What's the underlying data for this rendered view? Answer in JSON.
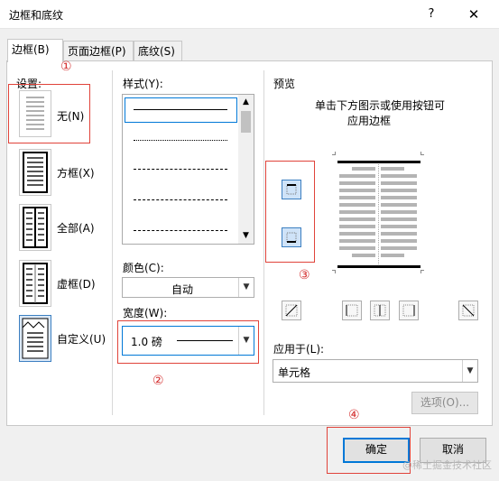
{
  "window": {
    "title": "边框和底纹",
    "help": "?",
    "close": "✕"
  },
  "tabs": [
    {
      "label": "边框(B)",
      "active": true
    },
    {
      "label": "页面边框(P)",
      "active": false
    },
    {
      "label": "底纹(S)",
      "active": false
    }
  ],
  "settings": {
    "heading": "设置:",
    "items": [
      {
        "label": "无(N)"
      },
      {
        "label": "方框(X)"
      },
      {
        "label": "全部(A)"
      },
      {
        "label": "虚框(D)"
      },
      {
        "label": "自定义(U)"
      }
    ]
  },
  "style": {
    "heading": "样式(Y):"
  },
  "color": {
    "heading": "颜色(C):",
    "value": "自动"
  },
  "width": {
    "heading": "宽度(W):",
    "value": "1.0 磅"
  },
  "preview": {
    "heading": "预览",
    "hint_line1": "单击下方图示或使用按钮可",
    "hint_line2": "应用边框"
  },
  "apply_to": {
    "heading": "应用于(L):",
    "value": "单元格"
  },
  "buttons": {
    "options": "选项(O)...",
    "ok": "确定",
    "cancel": "取消"
  },
  "annotations": {
    "n1": "①",
    "n2": "②",
    "n3": "③",
    "n4": "④"
  },
  "watermark": "@稀土掘金技术社区",
  "colors": {
    "annotation_red": "#e0433a",
    "default_button_border": "#0078d7"
  }
}
